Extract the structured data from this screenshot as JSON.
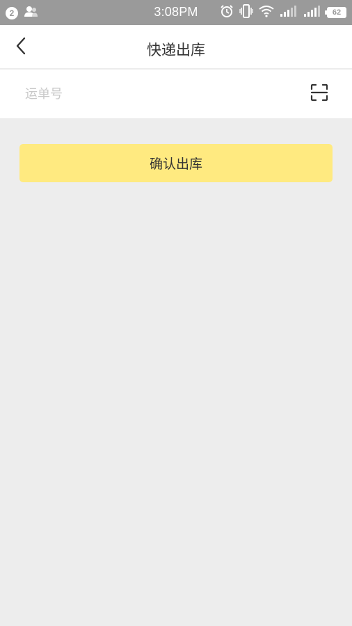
{
  "status_bar": {
    "notification_count": "2",
    "time": "3:08PM",
    "battery": "62",
    "icons": [
      "contacts-icon",
      "alarm-icon",
      "vibrate-icon",
      "wifi-icon",
      "signal-icon",
      "signal-icon"
    ]
  },
  "nav": {
    "title": "快递出库",
    "back_icon": "chevron-left-icon"
  },
  "waybill": {
    "placeholder": "运单号",
    "value": "",
    "scan_icon": "scan-icon"
  },
  "confirm": {
    "label": "确认出库",
    "color": "#ffea80"
  },
  "colors": {
    "status_bar": "#9a9a9a",
    "background": "#ededed"
  }
}
